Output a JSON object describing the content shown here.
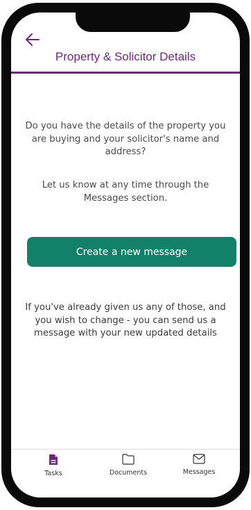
{
  "header": {
    "title": "Property & Solicitor Details"
  },
  "content": {
    "question": "Do you have the details of the property you are buying and your solicitor's name and address?",
    "hint": "Let us know at any time through the Messages section.",
    "button_label": "Create a new message",
    "note": "If you've already given us any of those, and you wish to change - you can send us a message with your new updated details"
  },
  "tabs": [
    {
      "label": "Tasks",
      "icon": "document-icon",
      "active": true
    },
    {
      "label": "Documents",
      "icon": "folder-icon",
      "active": false
    },
    {
      "label": "Messages",
      "icon": "envelope-icon",
      "active": false
    }
  ],
  "colors": {
    "accent": "#6a2a78",
    "button": "#13806a",
    "frame": "#0a0a0a"
  }
}
